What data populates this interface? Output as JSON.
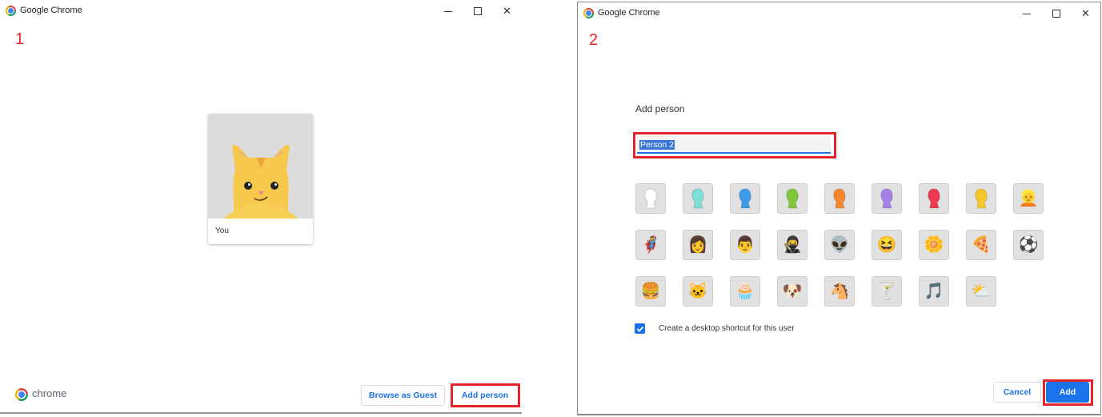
{
  "window1": {
    "app_title": "Google Chrome",
    "step_label": "1",
    "window_controls": {
      "minimize": "minimize-icon",
      "maximize": "maximize-icon",
      "close": "close-icon"
    },
    "profile": {
      "name": "You",
      "avatar": "cat-avatar"
    },
    "footer": {
      "brand_text": "chrome",
      "browse_guest_label": "Browse as Guest",
      "add_person_label": "Add person"
    },
    "highlight_color": "#e3242b"
  },
  "window2": {
    "app_title": "Google Chrome",
    "step_label": "2",
    "dialog_title": "Add person",
    "name_input_value": "Person 2",
    "avatars": [
      {
        "name": "generic-white",
        "kind": "head",
        "color": "#ffffff"
      },
      {
        "name": "generic-cyan",
        "kind": "head",
        "color": "#7fded6"
      },
      {
        "name": "generic-blue",
        "kind": "head",
        "color": "#3d9be9"
      },
      {
        "name": "generic-green",
        "kind": "head",
        "color": "#7fc63a"
      },
      {
        "name": "generic-orange",
        "kind": "head",
        "color": "#f7872e"
      },
      {
        "name": "generic-purple",
        "kind": "head",
        "color": "#a583e6"
      },
      {
        "name": "generic-red",
        "kind": "head",
        "color": "#ee3a4f"
      },
      {
        "name": "generic-yellow",
        "kind": "head",
        "color": "#f6c72c"
      },
      {
        "name": "secret-agent",
        "kind": "emoji",
        "glyph": "👱"
      },
      {
        "name": "superhero",
        "kind": "emoji",
        "glyph": "🦸"
      },
      {
        "name": "volleyball-player",
        "kind": "emoji",
        "glyph": "👩"
      },
      {
        "name": "businessman",
        "kind": "emoji",
        "glyph": "👨"
      },
      {
        "name": "ninja",
        "kind": "emoji",
        "glyph": "🥷"
      },
      {
        "name": "alien",
        "kind": "emoji",
        "glyph": "👽"
      },
      {
        "name": "awesome-smiley",
        "kind": "emoji",
        "glyph": "😆"
      },
      {
        "name": "flower",
        "kind": "emoji",
        "glyph": "🌼"
      },
      {
        "name": "pizza",
        "kind": "emoji",
        "glyph": "🍕"
      },
      {
        "name": "soccer-ball",
        "kind": "emoji",
        "glyph": "⚽"
      },
      {
        "name": "burger",
        "kind": "emoji",
        "glyph": "🍔"
      },
      {
        "name": "cat",
        "kind": "emoji",
        "glyph": "🐱"
      },
      {
        "name": "cupcake",
        "kind": "emoji",
        "glyph": "🧁"
      },
      {
        "name": "dog",
        "kind": "emoji",
        "glyph": "🐶"
      },
      {
        "name": "horse",
        "kind": "emoji",
        "glyph": "🐴"
      },
      {
        "name": "margarita",
        "kind": "emoji",
        "glyph": "🍸"
      },
      {
        "name": "music-note",
        "kind": "emoji",
        "glyph": "🎵"
      },
      {
        "name": "sun-and-cloud",
        "kind": "emoji",
        "glyph": "⛅"
      }
    ],
    "shortcut_checkbox": {
      "checked": true,
      "label": "Create a desktop shortcut for this user"
    },
    "cancel_label": "Cancel",
    "add_label": "Add",
    "accent_color": "#1a73e8"
  }
}
